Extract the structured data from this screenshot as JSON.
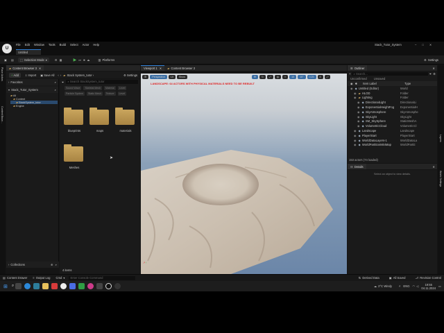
{
  "app": {
    "title": "Untitled",
    "project": "Stack_Tutor_System",
    "menu": [
      "File",
      "Edit",
      "Window",
      "Tools",
      "Build",
      "Select",
      "Actor",
      "Help"
    ]
  },
  "toolbar": {
    "save_label": "",
    "mode_label": "Selection Mode",
    "platforms_label": "Platforms",
    "settings_label": "Settings"
  },
  "content_browser": {
    "tab_label": "Content Browser 3",
    "add_label": "Add",
    "import_label": "Import",
    "save_all_label": "Save All",
    "path": [
      "All",
      "Content",
      "Stack System_tutor"
    ],
    "settings_label": "Settings",
    "favorites_label": "Favorites",
    "project_label": "Stack_Tutor_System",
    "tree": [
      "All",
      "Content",
      "StackSystem_tutor",
      "Engine"
    ],
    "search_placeholder": "Search StackSystem_tutor",
    "filters": [
      "Sound Wave",
      "Skeletal Mesh",
      "Material",
      "Level",
      "Particle System",
      "Static Mesh",
      "Texture",
      "Level"
    ],
    "folders": [
      "blueprints",
      "maps",
      "materials",
      "Meshes"
    ],
    "collections_label": "Collections",
    "item_count": "4 items"
  },
  "viewport": {
    "tab_label": "Viewport 1",
    "tab2_label": "Content Browser 2",
    "perspective_label": "Perspective",
    "lit_label": "Lit",
    "show_label": "Show",
    "warning": "LANDSCAPE: 64 ACTORS WITH PHYSICAL MATERIALS NEED TO BE REBUILT",
    "grid_value": "10",
    "angle_value": "10°",
    "scale_value": "0.25",
    "camera_speed": "4"
  },
  "outliner": {
    "tab_label": "Outliner",
    "search_placeholder": "Search...",
    "col_uncontrolled": "Unconfirmed",
    "col_unsaved": "Unsaved",
    "col_label": "Item Label",
    "col_type": "Type",
    "rows": [
      {
        "label": "Untitled (Editor)",
        "type": "World",
        "indent": 0
      },
      {
        "label": "HLOD",
        "type": "Folder",
        "indent": 1
      },
      {
        "label": "Lighting",
        "type": "Folder",
        "indent": 1
      },
      {
        "label": "DirectionalLight",
        "type": "DirectionalLi",
        "indent": 2
      },
      {
        "label": "ExponentialHeightFog",
        "type": "ExponentialH",
        "indent": 2
      },
      {
        "label": "SkyAtmosphere",
        "type": "SkyAtmosphe",
        "indent": 2
      },
      {
        "label": "SkyLight",
        "type": "SkyLight",
        "indent": 2
      },
      {
        "label": "SM_SkySphere",
        "type": "StaticMeshA",
        "indent": 2
      },
      {
        "label": "VolumetricCloud",
        "type": "VolumetricCl",
        "indent": 2
      },
      {
        "label": "Landscape",
        "type": "Landscape",
        "indent": 1
      },
      {
        "label": "PlayerStart",
        "type": "PlayerStart",
        "indent": 1
      },
      {
        "label": "WorldDataLayers-1",
        "type": "WorldDataLa",
        "indent": 1
      },
      {
        "label": "WorldPartitionMiniMap",
        "type": "WorldPartiti",
        "indent": 1
      }
    ],
    "actor_count": "153 actors (74 loaded)"
  },
  "details": {
    "tab_label": "Details",
    "empty_text": "Select an object to view details."
  },
  "status_bar": {
    "content_drawer": "Content Drawer",
    "output_log": "Output Log",
    "cmd_label": "Cmd",
    "cmd_placeholder": "Enter Console Command",
    "derived_data": "Derived Data",
    "all_saved": "All Saved",
    "revision_control": "Revision Control"
  },
  "taskbar": {
    "search_placeholder": "Search",
    "weather": "2°C Windy",
    "lang": "ENG",
    "time": "19:55",
    "date": "04.11.2024"
  },
  "side_tabs": {
    "left1": "Place Actors",
    "left2": "Content Brow...",
    "right1": "Layers",
    "right2": "World Settings"
  }
}
